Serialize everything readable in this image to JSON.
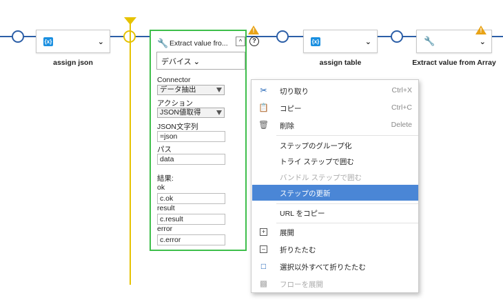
{
  "steps": {
    "assign_json": {
      "label": "assign json"
    },
    "assign_table": {
      "label": "assign table"
    },
    "extract_array": {
      "label": "Extract value from Array"
    }
  },
  "expanded_step": {
    "title": "Extract value fro...",
    "caret": "^",
    "help": "?",
    "device_selector": "デバイス",
    "connector_label": "Connector",
    "connector_value": "データ抽出",
    "action_label": "アクション",
    "action_value": "JSON値取得",
    "json_string_label": "JSON文字列",
    "json_string_value": "=json",
    "path_label": "パス",
    "path_value": "data",
    "results_label": "結果:",
    "ok_label": "ok",
    "ok_value": "c.ok",
    "result_label": "result",
    "result_value": "c.result",
    "error_label": "error",
    "error_value": "c.error"
  },
  "context_menu": {
    "items": [
      {
        "label": "切り取り",
        "shortcut": "Ctrl+X",
        "icon": "scissors-icon"
      },
      {
        "label": "コピー",
        "shortcut": "Ctrl+C",
        "icon": "copy-icon"
      },
      {
        "label": "削除",
        "shortcut": "Delete",
        "icon": "trash-icon"
      },
      {
        "label": "ステップのグループ化",
        "shortcut": ""
      },
      {
        "label": "トライ ステップで囲む",
        "shortcut": ""
      },
      {
        "label": "バンドル ステップで囲む",
        "shortcut": "",
        "disabled": true
      },
      {
        "label": "ステップの更新",
        "shortcut": "",
        "highlighted": true
      },
      {
        "label": "URL をコピー",
        "shortcut": ""
      },
      {
        "label": "展開",
        "shortcut": "",
        "icon": "expand-icon"
      },
      {
        "label": "折りたたむ",
        "shortcut": "",
        "icon": "collapse-icon"
      },
      {
        "label": "選択以外すべて折りたたむ",
        "shortcut": "",
        "icon": "collapse-others-icon"
      },
      {
        "label": "フローを展開",
        "shortcut": "",
        "icon": "flow-expand-icon",
        "disabled": true
      }
    ]
  },
  "colors": {
    "flow_line": "#2b5ea7",
    "insert_line": "#e6c200",
    "selected_border": "#3dbe4a",
    "menu_highlight": "#4a86d6",
    "warning": "#e8a317",
    "icon_blue": "#1a8fe0"
  }
}
